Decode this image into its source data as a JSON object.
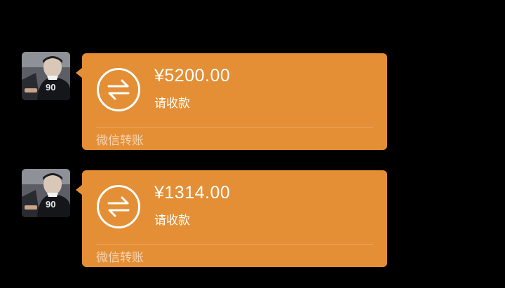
{
  "messages": [
    {
      "avatar_icon": "user-photo-icon",
      "amount": "¥5200.00",
      "status": "请收款",
      "footer": "微信转账",
      "transfer_icon": "transfer-arrows-icon"
    },
    {
      "avatar_icon": "user-photo-icon",
      "amount": "¥1314.00",
      "status": "请收款",
      "footer": "微信转账",
      "transfer_icon": "transfer-arrows-icon"
    }
  ],
  "colors": {
    "background": "#000000",
    "bubble": "#e48f35",
    "text": "#ffffff"
  }
}
